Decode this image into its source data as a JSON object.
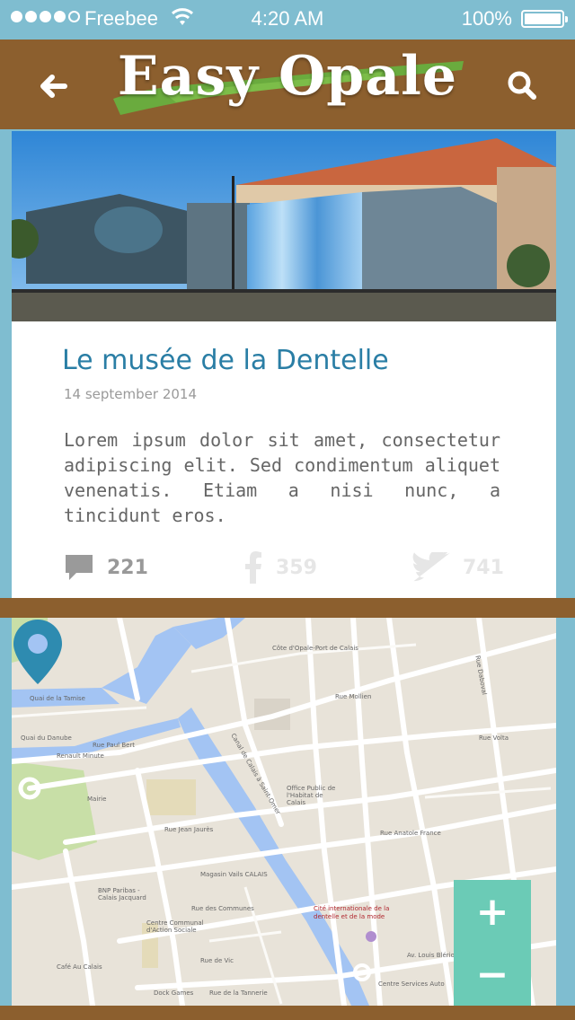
{
  "status_bar": {
    "carrier": "Freebee",
    "time": "4:20 AM",
    "battery": "100%"
  },
  "header": {
    "logo": "Easy Opale",
    "back_icon": "back-arrow-icon",
    "search_icon": "search-icon",
    "colors": {
      "header_bg": "#8c5f2e",
      "brush": "#6aab3e"
    }
  },
  "article": {
    "title": "Le musée de la Dentelle",
    "date": "14 september 2014",
    "body": "Lorem ipsum dolor sit amet, consectetur adipiscing elit. Sed condimentum aliquet venenatis. Etiam a nisi nunc, a tincidunt eros.",
    "stats": {
      "comments": "221",
      "facebook": "359",
      "twitter": "741"
    }
  },
  "map": {
    "labels": {
      "quai_tamise": "Quai de la Tamise",
      "quai_danube": "Quai du Danube",
      "rue_paul_bert": "Rue Paul Bert",
      "renault": "Renault Minute",
      "rue_jean_jaures": "Rue Jean Jaurès",
      "rue_mollien": "Rue Mollien",
      "rue_des_communes": "Rue des Communes",
      "rue_de_vic": "Rue de Vic",
      "rue_tannerie": "Rue de la Tannerie",
      "av_blerio": "Av. Louis Blériot",
      "rue_volta": "Rue Volta",
      "rue_daboval": "Rue Daboval",
      "rue_anatole": "Rue Anatole France",
      "canal": "Canal de Calais à Saint-Omer",
      "cote_opale": "Côte d'Opale-Port de Calais",
      "office": "Office Public de l'Habitat de Calais",
      "magasin": "Magasin Vails CALAIS",
      "bnp": "BNP Paribas - Calais Jacquard",
      "centre": "Centre Communal d'Action Sociale",
      "cafe": "Café Au Calais",
      "dock": "Dock Games",
      "centre_services": "Centre Services Auto",
      "mairie": "Mairie",
      "poi": "Cité internationale de la dentelle et de la mode"
    },
    "zoom_in": "+",
    "zoom_out": "−",
    "colors": {
      "water": "#a3c4f3",
      "road": "#ffffff",
      "land": "#e8e3d9",
      "park": "#c8dfa7",
      "zoom_bg": "#6bcbb6",
      "pin": "#2e8bb0"
    }
  }
}
